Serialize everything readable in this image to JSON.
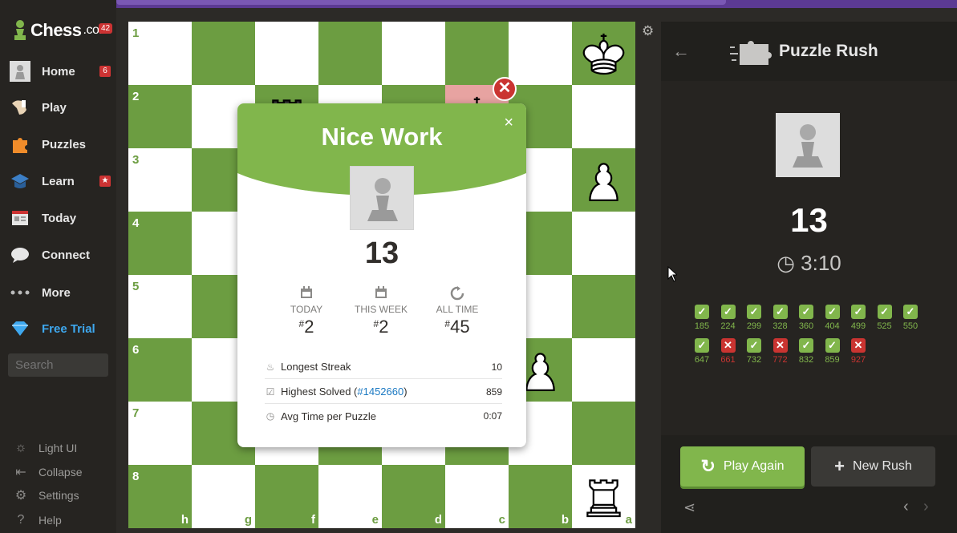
{
  "sidebar": {
    "logo_text": "Chess",
    "logo_suffix": ".com",
    "logo_badge": "42",
    "items": [
      {
        "label": "Home",
        "icon": "home-avatar-icon",
        "badge": "6"
      },
      {
        "label": "Play",
        "icon": "play-hand-icon",
        "badge": ""
      },
      {
        "label": "Puzzles",
        "icon": "puzzle-icon",
        "badge": ""
      },
      {
        "label": "Learn",
        "icon": "learn-cap-icon",
        "badge": "★"
      },
      {
        "label": "Today",
        "icon": "newspaper-icon",
        "badge": ""
      },
      {
        "label": "Connect",
        "icon": "chat-bubble-icon",
        "badge": ""
      },
      {
        "label": "More",
        "icon": "more-dots-icon",
        "badge": ""
      },
      {
        "label": "Free Trial",
        "icon": "diamond-icon",
        "badge": ""
      }
    ],
    "search_placeholder": "Search",
    "bottom": [
      {
        "label": "Light UI",
        "icon": "sun-icon"
      },
      {
        "label": "Collapse",
        "icon": "collapse-icon"
      },
      {
        "label": "Settings",
        "icon": "gear-icon"
      },
      {
        "label": "Help",
        "icon": "help-icon"
      }
    ]
  },
  "board": {
    "ranks": [
      "1",
      "2",
      "3",
      "4",
      "5",
      "6",
      "7",
      "8"
    ],
    "files": [
      "h",
      "g",
      "f",
      "e",
      "d",
      "c",
      "b",
      "a"
    ],
    "highlight_color": "#e7a3a1",
    "light_color": "#ffffff",
    "dark_color": "#6c9d41"
  },
  "modal": {
    "title": "Nice Work",
    "close": "×",
    "score": "13",
    "stats": [
      {
        "label": "TODAY",
        "prefix": "#",
        "value": "2"
      },
      {
        "label": "THIS WEEK",
        "prefix": "#",
        "value": "2"
      },
      {
        "label": "ALL TIME",
        "prefix": "#",
        "value": "45"
      }
    ],
    "rows": [
      {
        "label": "Longest Streak",
        "value": "10"
      },
      {
        "label": "Highest Solved (",
        "link": "#1452660",
        "label_end": ")",
        "value": "859"
      },
      {
        "label": "Avg Time per Puzzle",
        "value": "0:07"
      }
    ]
  },
  "panel": {
    "title": "Puzzle Rush",
    "score": "13",
    "timer": "3:10",
    "attempts": [
      {
        "rating": "185",
        "result": "correct"
      },
      {
        "rating": "224",
        "result": "correct"
      },
      {
        "rating": "299",
        "result": "correct"
      },
      {
        "rating": "328",
        "result": "correct"
      },
      {
        "rating": "360",
        "result": "correct"
      },
      {
        "rating": "404",
        "result": "correct"
      },
      {
        "rating": "499",
        "result": "correct"
      },
      {
        "rating": "525",
        "result": "correct"
      },
      {
        "rating": "550",
        "result": "correct"
      },
      {
        "rating": "647",
        "result": "correct"
      },
      {
        "rating": "661",
        "result": "wrong"
      },
      {
        "rating": "732",
        "result": "correct"
      },
      {
        "rating": "772",
        "result": "wrong"
      },
      {
        "rating": "832",
        "result": "correct"
      },
      {
        "rating": "859",
        "result": "correct"
      },
      {
        "rating": "927",
        "result": "wrong"
      }
    ],
    "play_again": "Play Again",
    "new_rush": "New Rush"
  },
  "colors": {
    "accent_green": "#81b64c",
    "error_red": "#ca3431",
    "link_blue": "#1b79c2",
    "trial_blue": "#3ea8ef"
  }
}
